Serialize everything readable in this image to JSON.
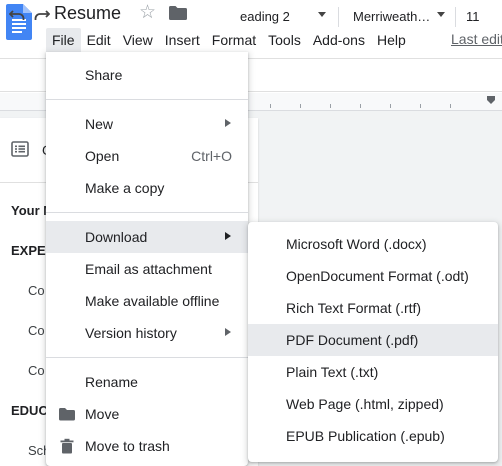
{
  "header": {
    "title": "Resume",
    "last_edit": "Last edit"
  },
  "menubar": [
    "File",
    "Edit",
    "View",
    "Insert",
    "Format",
    "Tools",
    "Add-ons",
    "Help"
  ],
  "toolbar": {
    "style": "eading 2",
    "font": "Merriweath…",
    "size": "11"
  },
  "outline": {
    "heading": "O",
    "items": [
      "Your N",
      "EXPE",
      "Co",
      "Co",
      "Co",
      "EDUC",
      "Sch"
    ]
  },
  "file_menu": {
    "share": "Share",
    "new": "New",
    "open": "Open",
    "open_shortcut": "Ctrl+O",
    "make_copy": "Make a copy",
    "download": "Download",
    "email": "Email as attachment",
    "offline": "Make available offline",
    "version_history": "Version history",
    "rename": "Rename",
    "move": "Move",
    "trash": "Move to trash"
  },
  "download_menu": [
    "Microsoft Word (.docx)",
    "OpenDocument Format (.odt)",
    "Rich Text Format (.rtf)",
    "PDF Document (.pdf)",
    "Plain Text (.txt)",
    "Web Page (.html, zipped)",
    "EPUB Publication (.epub)"
  ],
  "colors": {
    "docs_blue": "#4285f4",
    "menu_hover": "#e8eaed",
    "icon_gray": "#5f6368"
  }
}
